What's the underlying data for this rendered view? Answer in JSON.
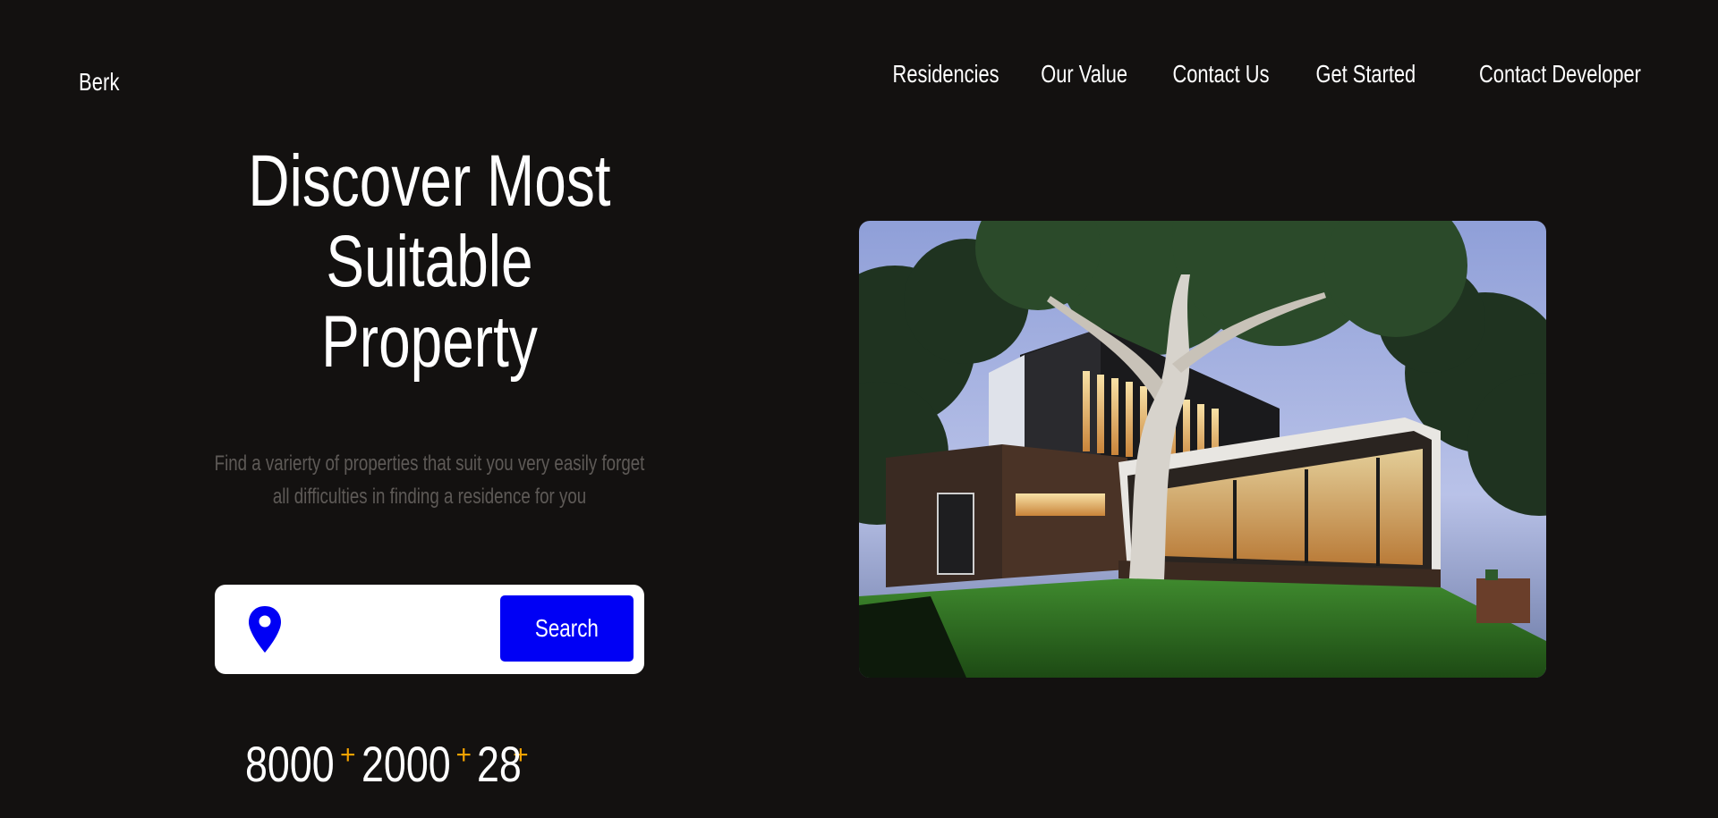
{
  "header": {
    "logo": "Berk",
    "nav": [
      "Residencies",
      "Our Value",
      "Contact Us",
      "Get Started",
      "Contact Developer"
    ]
  },
  "hero": {
    "title_lines": [
      "Discover Most",
      "Suitable",
      "Property"
    ],
    "subtitle_lines": [
      "Find a varierty of properties that suit you very easily forget",
      "all difficulties in finding a residence for you"
    ]
  },
  "search": {
    "placeholder": "",
    "value": "",
    "button_label": "Search",
    "icon": "location-pin-icon"
  },
  "stats": [
    {
      "value": "8000",
      "suffix": "+"
    },
    {
      "value": "2000",
      "suffix": "+"
    },
    {
      "value": "28",
      "suffix": "+"
    }
  ],
  "colors": {
    "background": "#131110",
    "accent_blue": "#0000f5",
    "accent_orange": "#f5a300",
    "muted_text": "#5e5a57"
  },
  "image": {
    "subject": "modern-house-at-dusk"
  }
}
